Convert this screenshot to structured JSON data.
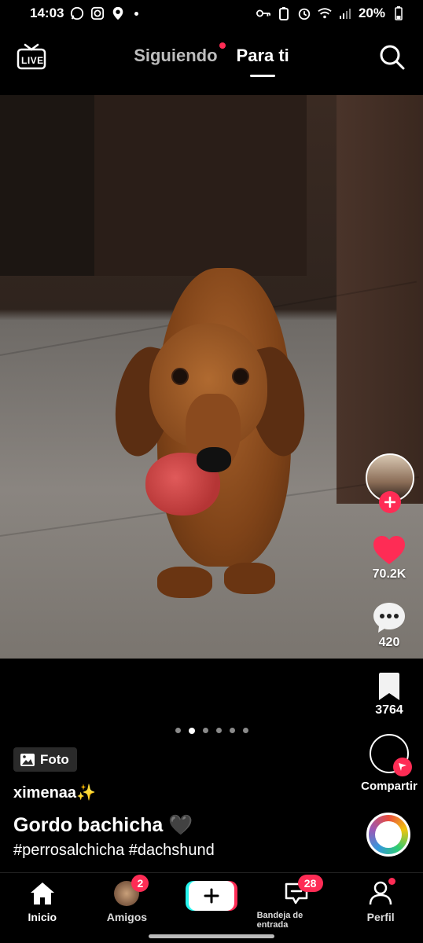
{
  "status_bar": {
    "time": "14:03",
    "battery": "20%"
  },
  "top_nav": {
    "live_label": "LIVE",
    "tabs": [
      {
        "label": "Siguiendo"
      },
      {
        "label": "Para ti"
      }
    ]
  },
  "rail": {
    "likes": "70.2K",
    "comments": "420",
    "bookmarks": "3764",
    "share_label": "Compartir"
  },
  "post": {
    "type_badge": "Foto",
    "username": "ximenaa✨",
    "caption": "Gordo bachicha 🖤",
    "hashtags": "#perrosalchicha #dachshund",
    "carousel": {
      "count": 6,
      "active_index": 1
    }
  },
  "bottom_nav": {
    "home_label": "Inicio",
    "friends_label": "Amigos",
    "friends_count": "2",
    "inbox_label": "Bandeja de entrada",
    "inbox_count": "28",
    "profile_label": "Perfil"
  },
  "colors": {
    "accent": "#fe2c55",
    "cyan": "#25f4ee"
  }
}
